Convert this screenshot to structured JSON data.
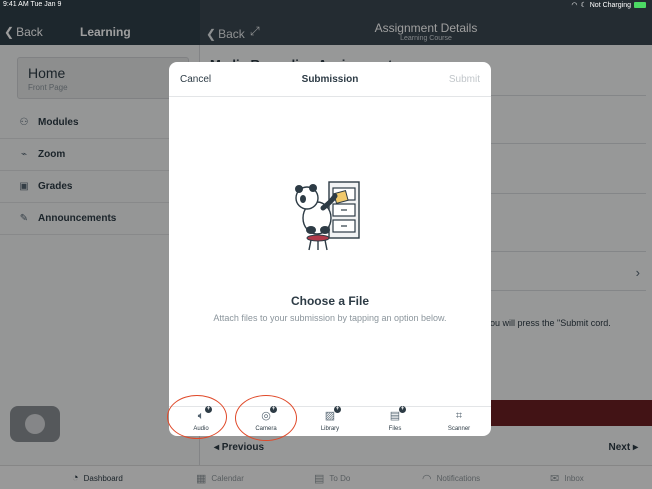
{
  "status_bar": {
    "time": "9:41 AM  Tue Jan 9",
    "battery_text": "Not Charging"
  },
  "left_nav": {
    "back_label": "Back",
    "title": "Learning"
  },
  "right_nav": {
    "back_label": "Back",
    "title": "Assignment Details",
    "subtitle": "Learning Course"
  },
  "sidebar": {
    "home": {
      "title": "Home",
      "subtitle": "Front Page"
    },
    "items": [
      {
        "label": "Modules",
        "icon": "modules-icon"
      },
      {
        "label": "Zoom",
        "icon": "zoom-plug-icon"
      },
      {
        "label": "Grades",
        "icon": "grades-icon"
      },
      {
        "label": "Announcements",
        "icon": "announcements-icon"
      }
    ]
  },
  "main": {
    "peek_title": "Media Recording Assignment",
    "paragraph": "ou will press the \"Submit cord.",
    "previous_label": "◂ Previous",
    "next_label": "Next ▸"
  },
  "modal": {
    "cancel_label": "Cancel",
    "title": "Submission",
    "submit_label": "Submit",
    "heading": "Choose a File",
    "description": "Attach files to your submission by tapping an option below.",
    "options": [
      {
        "label": "Audio",
        "icon": "audio-icon"
      },
      {
        "label": "Camera",
        "icon": "camera-icon"
      },
      {
        "label": "Library",
        "icon": "library-icon"
      },
      {
        "label": "Files",
        "icon": "files-icon"
      },
      {
        "label": "Scanner",
        "icon": "scanner-icon"
      }
    ]
  },
  "tabbar": {
    "items": [
      {
        "label": "Dashboard",
        "icon": "dashboard-icon"
      },
      {
        "label": "Calendar",
        "icon": "calendar-icon"
      },
      {
        "label": "To Do",
        "icon": "todo-icon"
      },
      {
        "label": "Notifications",
        "icon": "bell-icon"
      },
      {
        "label": "Inbox",
        "icon": "inbox-icon"
      }
    ]
  },
  "colors": {
    "nav_dark": "#2f3f4a",
    "accent_red": "#e04a2a",
    "brand_maroon": "#6b2022"
  }
}
